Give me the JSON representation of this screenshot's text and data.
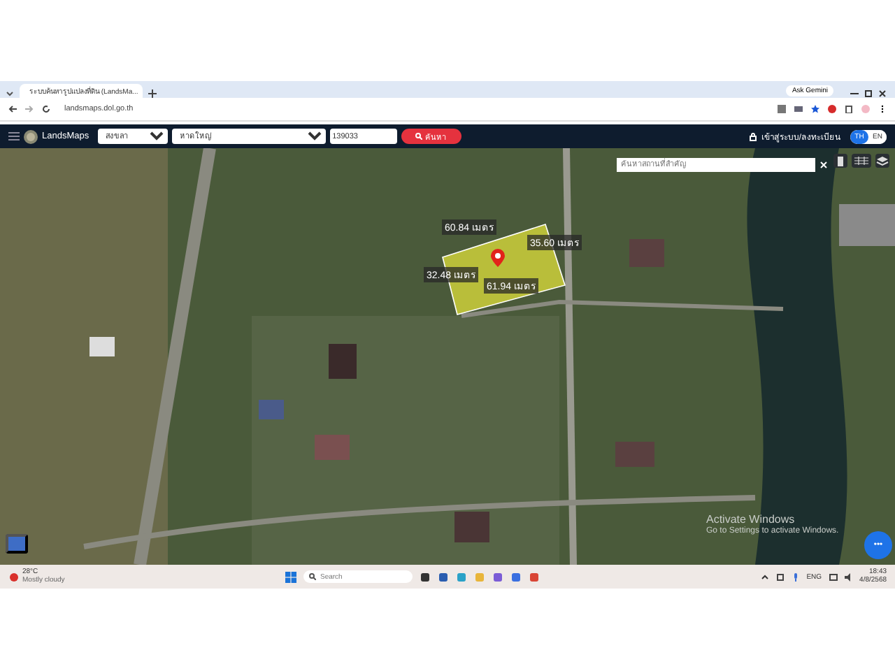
{
  "browser": {
    "tab_title": "ระบบค้นหารูปแปลงที่ดิน (LandsMa...",
    "ask_button": "Ask Gemini",
    "url": "landsmaps.dol.go.th"
  },
  "app": {
    "logo": "LandsMaps",
    "province": "สงขลา",
    "district": "หาดใหญ่",
    "parcel_number": "139033",
    "search_button": "ค้นหา",
    "login": "เข้าสู่ระบบ/ลงทะเบียน",
    "languages": [
      {
        "label": "TH",
        "selected": true
      },
      {
        "label": "EN",
        "selected": false
      }
    ]
  },
  "map": {
    "place_search": {
      "placeholder": "ค้นหาสถานที่สำคัญ"
    },
    "parcel_sides": [
      {
        "label": "60.84 เมตร"
      },
      {
        "label": "35.60 เมตร"
      },
      {
        "label": "32.48 เมตร"
      },
      {
        "label": "61.94 เมตร"
      }
    ],
    "activation_notice": {
      "title": "Activate Windows",
      "subtitle": "Go to Settings to activate Windows."
    },
    "fab_label": "•••"
  },
  "taskbar": {
    "weather": {
      "temperature": "28°C",
      "condition": "Mostly cloudy"
    },
    "search": "Search",
    "language": "ENG",
    "time": "18:43",
    "date": "4/8/2568"
  }
}
